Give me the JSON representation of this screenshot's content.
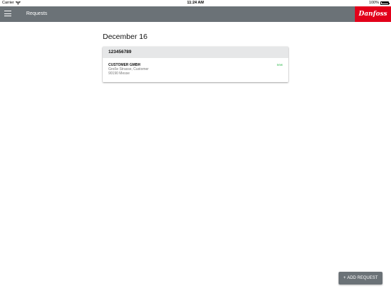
{
  "status_bar": {
    "carrier": "Carrier",
    "time": "11:24 AM",
    "battery": "100%"
  },
  "app_bar": {
    "title": "Requests",
    "logo_text": "Danfoss",
    "color": "#6b7277",
    "logo_color": "#e2001a"
  },
  "main": {
    "date_heading": "December 16",
    "requests": [
      {
        "number": "123456789",
        "customer": "CUSTOMER GMBH",
        "address_line1": "Große Strasse, Customer",
        "address_line2": "90190 Messe",
        "status": "new",
        "status_color": "#2eb84a"
      }
    ]
  },
  "add_button": {
    "icon": "plus-icon",
    "label": "ADD REQUEST"
  }
}
